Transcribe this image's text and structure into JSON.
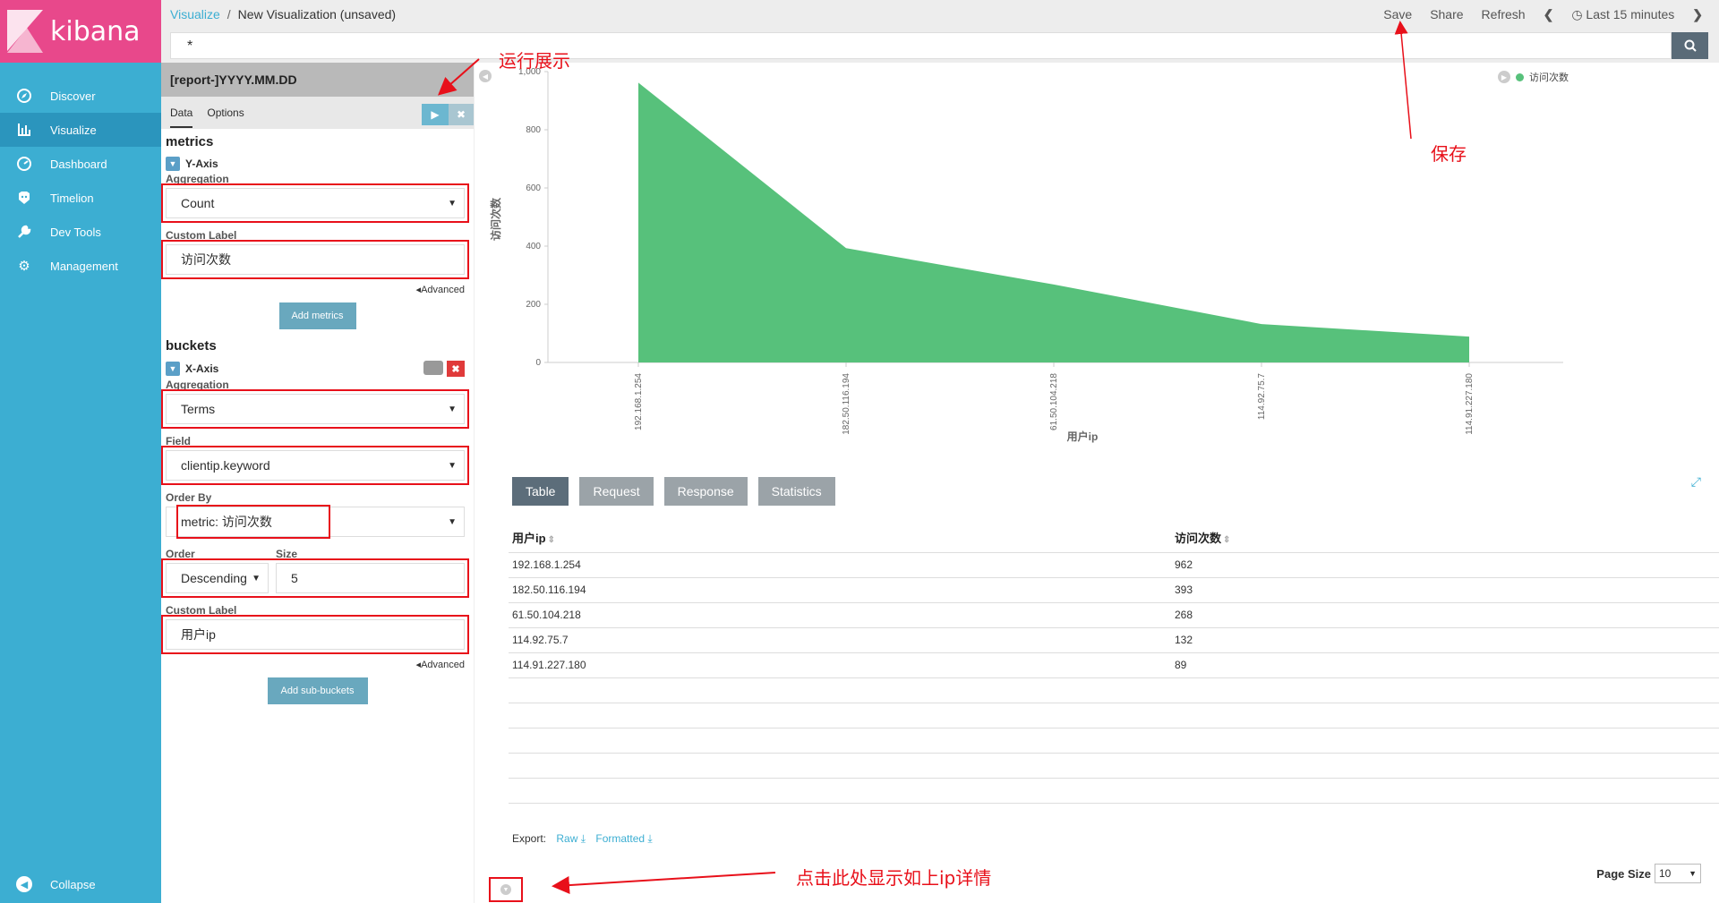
{
  "app": {
    "logo_text": "kibana"
  },
  "nav": {
    "items": [
      {
        "label": "Discover",
        "icon": "compass-icon"
      },
      {
        "label": "Visualize",
        "icon": "bar-chart-icon",
        "active": true
      },
      {
        "label": "Dashboard",
        "icon": "dashboard-icon"
      },
      {
        "label": "Timelion",
        "icon": "timelion-icon"
      },
      {
        "label": "Dev Tools",
        "icon": "wrench-icon"
      },
      {
        "label": "Management",
        "icon": "gear-icon"
      }
    ],
    "collapse_label": "Collapse"
  },
  "topbar": {
    "breadcrumb_link": "Visualize",
    "breadcrumb_sep": "/",
    "breadcrumb_current": "New Visualization (unsaved)",
    "save": "Save",
    "share": "Share",
    "refresh": "Refresh",
    "time_range": "Last 15 minutes"
  },
  "search": {
    "value": "*"
  },
  "editor": {
    "index_pattern": "[report-]YYYY.MM.DD",
    "tab_data": "Data",
    "tab_options": "Options",
    "metrics_title": "metrics",
    "y_axis_label": "Y-Axis",
    "aggregation_label": "Aggregation",
    "metric_aggregation": "Count",
    "custom_label_label": "Custom Label",
    "metric_custom_label": "访问次数",
    "advanced": "Advanced",
    "add_metrics": "Add metrics",
    "buckets_title": "buckets",
    "x_axis_label": "X-Axis",
    "bucket_aggregation": "Terms",
    "field_label": "Field",
    "field_value": "clientip.keyword",
    "order_by_label": "Order By",
    "order_by_value": "metric: 访问次数",
    "order_label": "Order",
    "order_value": "Descending",
    "size_label": "Size",
    "size_value": "5",
    "bucket_custom_label": "用户ip",
    "add_sub_buckets": "Add sub-buckets"
  },
  "chart_data": {
    "type": "area",
    "categories": [
      "192.168.1.254",
      "182.50.116.194",
      "61.50.104.218",
      "114.92.75.7",
      "114.91.227.180"
    ],
    "series": [
      {
        "name": "访问次数",
        "values": [
          962,
          393,
          268,
          132,
          89
        ],
        "color": "#57c17b"
      }
    ],
    "xlabel": "用户ip",
    "ylabel": "访问次数",
    "ylim": [
      0,
      1000
    ],
    "yticks": [
      "0",
      "200",
      "400",
      "600",
      "800",
      "1,000"
    ],
    "legend": "top-right",
    "grid": false
  },
  "spy": {
    "tabs": [
      "Table",
      "Request",
      "Response",
      "Statistics"
    ],
    "active_tab": "Table",
    "columns": [
      "用户ip",
      "访问次数"
    ],
    "rows": [
      [
        "192.168.1.254",
        "962"
      ],
      [
        "182.50.116.194",
        "393"
      ],
      [
        "61.50.104.218",
        "268"
      ],
      [
        "114.92.75.7",
        "132"
      ],
      [
        "114.91.227.180",
        "89"
      ]
    ],
    "export_label": "Export:",
    "export_raw": "Raw",
    "export_formatted": "Formatted",
    "page_size_label": "Page Size",
    "page_size_value": "10"
  },
  "annotations": {
    "run": "运行展示",
    "save": "保存",
    "details": "点击此处显示如上ip详情"
  }
}
